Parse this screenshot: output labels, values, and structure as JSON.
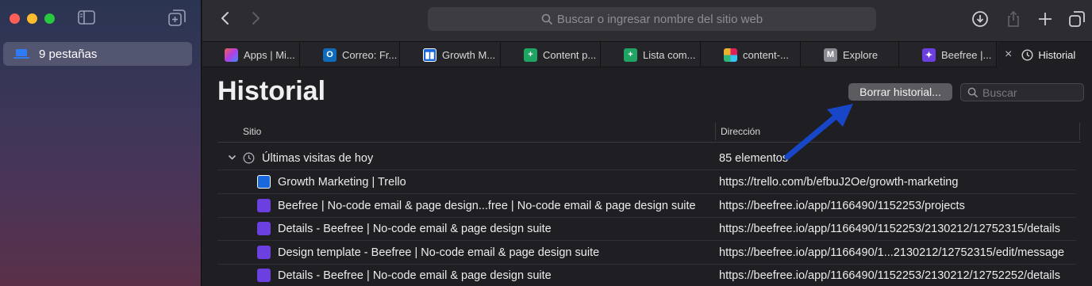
{
  "sidebar": {
    "tab_group_label": "9 pestañas"
  },
  "toolbar": {
    "address_placeholder": "Buscar o ingresar nombre del sitio web"
  },
  "tabs": [
    {
      "label": "Apps | Mi...",
      "icon": "microsoft-apps-icon",
      "color": "#e24a8d"
    },
    {
      "label": "Correo: Fr...",
      "icon": "outlook-icon",
      "color": "#0f6cbd"
    },
    {
      "label": "Growth M...",
      "icon": "trello-icon",
      "color": "#1868db"
    },
    {
      "label": "Content p...",
      "icon": "google-sheets-icon",
      "color": "#1fa463"
    },
    {
      "label": "Lista com...",
      "icon": "google-sheets-icon",
      "color": "#1fa463"
    },
    {
      "label": "content-...",
      "icon": "slack-icon",
      "color": "#611f69"
    },
    {
      "label": "Explore",
      "icon": "m-icon",
      "color": "#8a8a92"
    },
    {
      "label": "Beefree |...",
      "icon": "beefree-icon",
      "color": "#6b3fe0"
    },
    {
      "label": "Historial",
      "icon": "clock-icon",
      "color": "#d0d0d0"
    }
  ],
  "page": {
    "title": "Historial",
    "clear_button": "Borrar historial...",
    "search_placeholder": "Buscar"
  },
  "table": {
    "col_site": "Sitio",
    "col_address": "Dirección",
    "group": {
      "label": "Últimas visitas de hoy",
      "count": "85 elementos"
    },
    "rows": [
      {
        "site": "Growth Marketing | Trello",
        "address": "https://trello.com/b/efbuJ2Oe/growth-marketing",
        "icon": "trello-icon"
      },
      {
        "site": "Beefree | No-code email & page design...free | No-code email & page design suite",
        "address": "https://beefree.io/app/1166490/1152253/projects",
        "icon": "beefree-icon"
      },
      {
        "site": "Details - Beefree | No-code email & page design suite",
        "address": "https://beefree.io/app/1166490/1152253/2130212/12752315/details",
        "icon": "beefree-icon"
      },
      {
        "site": "Design template - Beefree | No-code email & page design suite",
        "address": "https://beefree.io/app/1166490/1...2130212/12752315/edit/message",
        "icon": "beefree-icon"
      },
      {
        "site": "Details - Beefree | No-code email & page design suite",
        "address": "https://beefree.io/app/1166490/1152253/2130212/12752252/details",
        "icon": "beefree-icon"
      }
    ]
  },
  "colors": {
    "accent_arrow": "#1747c8",
    "trello": "#1868db",
    "beefree": "#6b3fe0"
  }
}
